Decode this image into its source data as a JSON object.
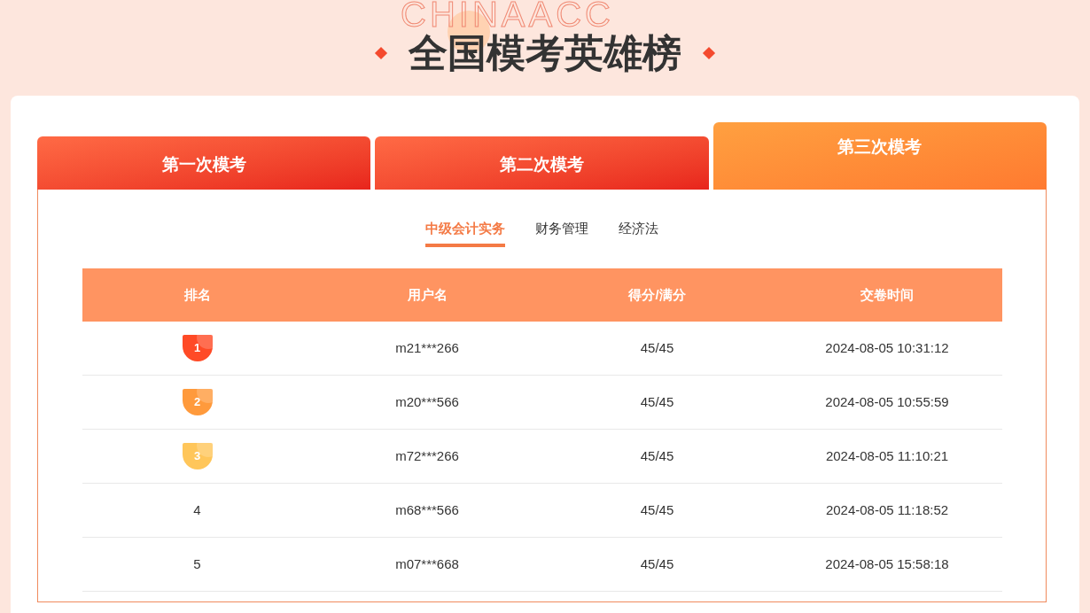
{
  "header": {
    "background_word": "CHINAACC",
    "title": "全国模考英雄榜"
  },
  "exam_tabs": [
    {
      "label": "第一次模考",
      "selected": false
    },
    {
      "label": "第二次模考",
      "selected": false
    },
    {
      "label": "第三次模考",
      "selected": true
    }
  ],
  "subject_tabs": [
    {
      "label": "中级会计实务",
      "selected": true
    },
    {
      "label": "财务管理",
      "selected": false
    },
    {
      "label": "经济法",
      "selected": false
    }
  ],
  "table": {
    "columns": [
      "排名",
      "用户名",
      "得分/满分",
      "交卷时间"
    ],
    "rows": [
      {
        "rank": "1",
        "kind": "medal",
        "color": "#ff4a26",
        "user": "m21***266",
        "score": "45/45",
        "time": "2024-08-05 10:31:12"
      },
      {
        "rank": "2",
        "kind": "medal",
        "color": "#ff9a3c",
        "user": "m20***566",
        "score": "45/45",
        "time": "2024-08-05 10:55:59"
      },
      {
        "rank": "3",
        "kind": "medal",
        "color": "#ffc65a",
        "user": "m72***266",
        "score": "45/45",
        "time": "2024-08-05 11:10:21"
      },
      {
        "rank": "4",
        "kind": "plain",
        "user": "m68***566",
        "score": "45/45",
        "time": "2024-08-05 11:18:52"
      },
      {
        "rank": "5",
        "kind": "plain",
        "user": "m07***668",
        "score": "45/45",
        "time": "2024-08-05 15:58:18"
      }
    ]
  }
}
